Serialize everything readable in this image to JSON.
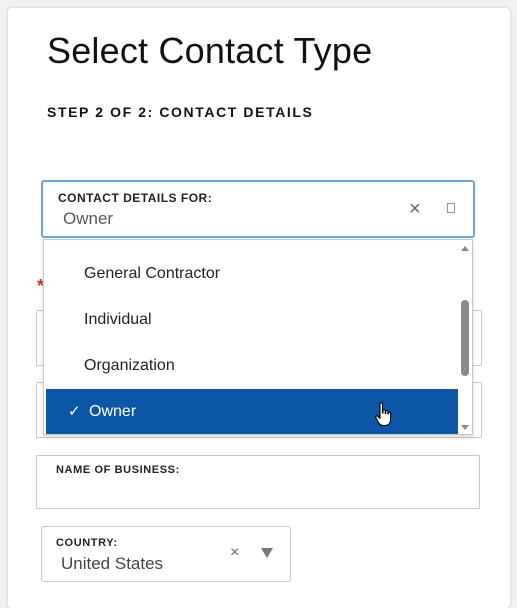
{
  "page": {
    "title": "Select Contact Type",
    "step": "STEP 2 OF 2: CONTACT DETAILS"
  },
  "contact_details": {
    "label": "CONTACT DETAILS FOR:",
    "value": "Owner",
    "clear_glyph": "×",
    "icons": [
      "close-icon",
      "clipboard-icon"
    ],
    "options": [
      "General Contractor",
      "Individual",
      "Organization",
      "Owner"
    ],
    "selected_index": 3,
    "check_glyph": "✓"
  },
  "required_mark": "*",
  "name_of_business": {
    "label": "NAME OF BUSINESS:",
    "value": ""
  },
  "country": {
    "label": "COUNTRY:",
    "value": "United States",
    "clear_glyph": "×",
    "icons": [
      "close-icon",
      "chevron-down-icon"
    ]
  },
  "colors": {
    "accent": "#0b57a6",
    "focus_border": "#6ea4d2",
    "required": "#c0392b"
  }
}
